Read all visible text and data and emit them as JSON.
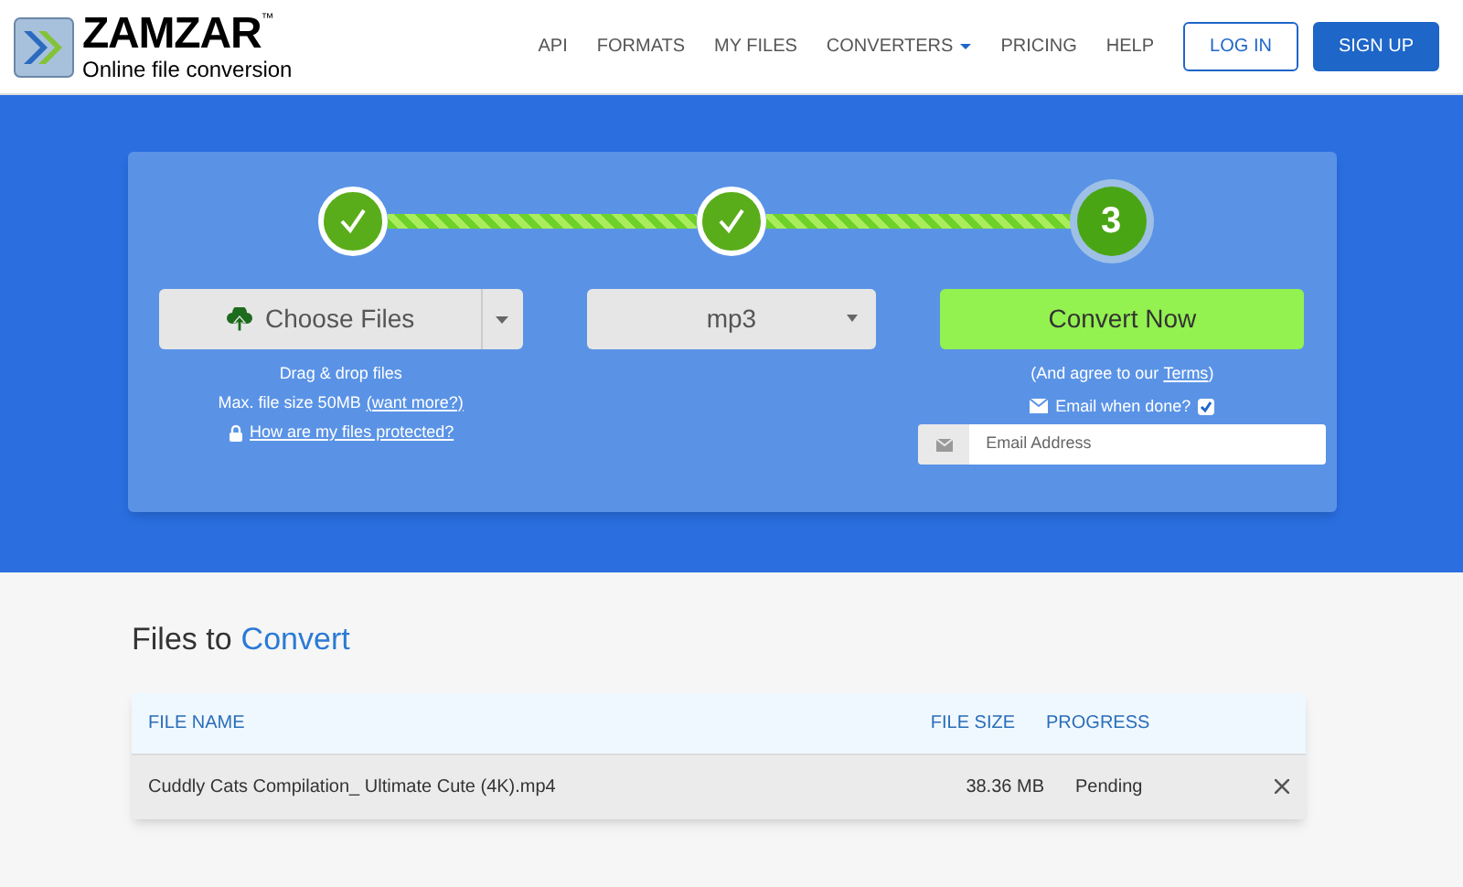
{
  "logo": {
    "name": "ZAMZAR",
    "trademark": "™",
    "tagline": "Online file conversion"
  },
  "nav": {
    "links": [
      {
        "label": "API",
        "dropdown": false
      },
      {
        "label": "FORMATS",
        "dropdown": false
      },
      {
        "label": "MY FILES",
        "dropdown": false
      },
      {
        "label": "CONVERTERS",
        "dropdown": true
      },
      {
        "label": "PRICING",
        "dropdown": false
      },
      {
        "label": "HELP",
        "dropdown": false
      }
    ],
    "login": "LOG IN",
    "signup": "SIGN UP"
  },
  "steps": [
    {
      "kind": "done"
    },
    {
      "kind": "done"
    },
    {
      "kind": "current",
      "label": "3"
    }
  ],
  "choose": {
    "label": "Choose Files",
    "drag_text": "Drag & drop files",
    "max_size": "Max. file size 50MB",
    "want_more": "(want more?)",
    "protected_link": "How are my files protected?"
  },
  "format": {
    "value": "mp3"
  },
  "convert": {
    "label": "Convert Now",
    "agree_prefix": "(And agree to our",
    "terms": "Terms",
    "agree_suffix": ")",
    "email_label": "Email when done?",
    "email_checked": true,
    "email_placeholder": "Email Address"
  },
  "files": {
    "heading_prefix": "Files to",
    "heading_highlight": "Convert",
    "columns": [
      "FILE NAME",
      "FILE SIZE",
      "PROGRESS"
    ],
    "rows": [
      {
        "name": "Cuddly Cats Compilation_ Ultimate Cute (4K).mp4",
        "size": "38.36 MB",
        "progress": "Pending"
      }
    ]
  }
}
